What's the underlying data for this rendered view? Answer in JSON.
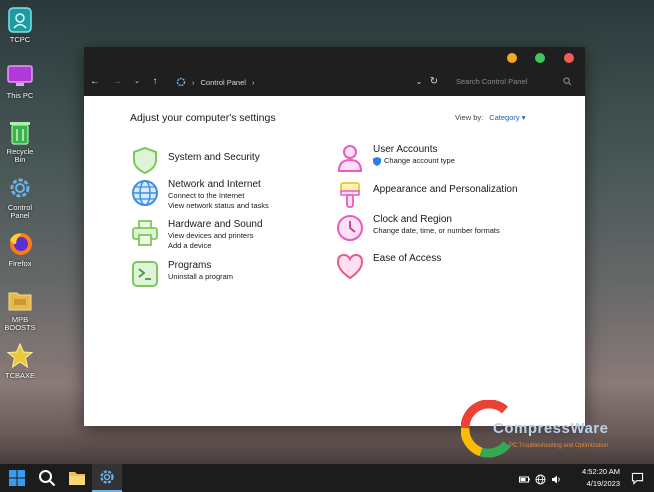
{
  "desktop": {
    "icons": [
      {
        "label": "TCPC",
        "icon": "user-folder-icon"
      },
      {
        "label": "This PC",
        "icon": "monitor-icon"
      },
      {
        "label": "Recycle Bin",
        "icon": "recycle-bin-icon"
      },
      {
        "label": "Control Panel",
        "icon": "gear-icon"
      },
      {
        "label": "Firefox",
        "icon": "firefox-icon"
      },
      {
        "label": "MPB BOOSTS",
        "icon": "folder-icon"
      },
      {
        "label": "TCBAXE",
        "icon": "star-icon"
      }
    ]
  },
  "window": {
    "breadcrumb": "Control Panel",
    "search_placeholder": "Search Control Panel",
    "heading": "Adjust your computer's settings",
    "view_by_label": "View by:",
    "view_by_value": "Category"
  },
  "categories": {
    "system": {
      "title": "System and Security"
    },
    "network": {
      "title": "Network and Internet",
      "links": [
        "Connect to the Internet",
        "View network status and tasks"
      ]
    },
    "hardware": {
      "title": "Hardware and Sound",
      "links": [
        "View devices and printers",
        "Add a device"
      ]
    },
    "programs": {
      "title": "Programs",
      "links": [
        "Uninstall a program"
      ]
    },
    "users": {
      "title": "User Accounts",
      "links": [
        "Change account type"
      ]
    },
    "appearance": {
      "title": "Appearance and Personalization"
    },
    "clock": {
      "title": "Clock and Region",
      "links": [
        "Change date, time, or number formats"
      ]
    },
    "ease": {
      "title": "Ease of Access"
    }
  },
  "taskbar": {
    "time": "4:52:20 AM",
    "date": "4/19/2023"
  },
  "watermark": {
    "brand": "CompressWare",
    "tagline": "PC Troubleshooting and Optimization"
  },
  "colors": {
    "close": "#f25c54",
    "maximize": "#3cc95a",
    "minimize": "#f5a623",
    "accent": "#1a5fb4"
  }
}
